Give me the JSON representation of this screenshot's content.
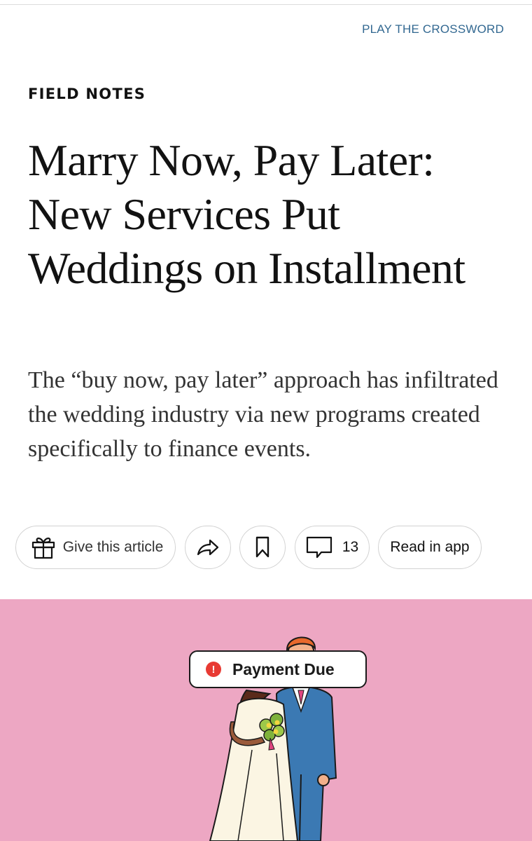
{
  "header": {
    "crossword_link": "PLAY THE CROSSWORD"
  },
  "article": {
    "kicker": "FIELD NOTES",
    "headline": "Marry Now, Pay Later: New Services Put Weddings on Installment",
    "dek": "The “buy now, pay later” approach has infiltrated the wedding industry via new programs created specifically to finance events."
  },
  "actions": {
    "gift_label": "Give this article",
    "comment_count": "13",
    "read_in_app_label": "Read in app"
  },
  "illustration": {
    "badge_text": "Payment Due",
    "badge_icon": "alert-icon",
    "badge_icon_glyph": "!",
    "background_color": "#eda7c3"
  },
  "icons": {
    "gift": "gift-icon",
    "share": "share-icon",
    "save": "bookmark-icon",
    "comments": "comment-icon"
  }
}
